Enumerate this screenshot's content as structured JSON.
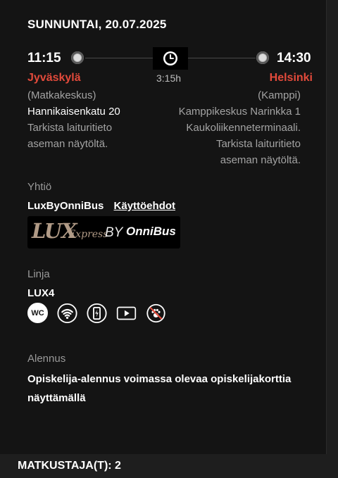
{
  "trip": {
    "date": "SUNNUNTAI, 20.07.2025",
    "departure": {
      "time": "11:15",
      "city": "Jyväskylä",
      "station": "(Matkakeskus)",
      "address": "Hannikaisenkatu 20",
      "note1": "Tarkista laituritieto",
      "note2": "aseman näytöltä."
    },
    "arrival": {
      "time": "14:30",
      "city": "Helsinki",
      "station": "(Kamppi)",
      "address": "Kamppikeskus Narinkka 1",
      "address2": "Kaukoliikenneterminaali.",
      "note1": "Tarkista laituritieto",
      "note2": "aseman näytöltä."
    },
    "duration": "3:15h"
  },
  "company": {
    "label": "Yhtiö",
    "name": "LuxByOnniBus",
    "terms_link": "Käyttöehdot",
    "logo_text_lux": "LUX",
    "logo_text_express": "Express",
    "logo_text_by": "BY",
    "logo_text_onnibus": "OnniBus"
  },
  "line": {
    "label": "Linja",
    "value": "LUX4",
    "amenities": [
      "wc-icon",
      "wifi-icon",
      "charging-icon",
      "entertainment-icon",
      "no-pets-icon"
    ],
    "wc_text": "WC"
  },
  "discount": {
    "label": "Alennus",
    "text": "Opiskelija-alennus voimassa olevaa opiskelijakorttia näyttämällä"
  },
  "passengers": {
    "text": "MATKUSTAJA(T): 2"
  },
  "colors": {
    "accent_red": "#e24a3b",
    "background": "#141414"
  }
}
